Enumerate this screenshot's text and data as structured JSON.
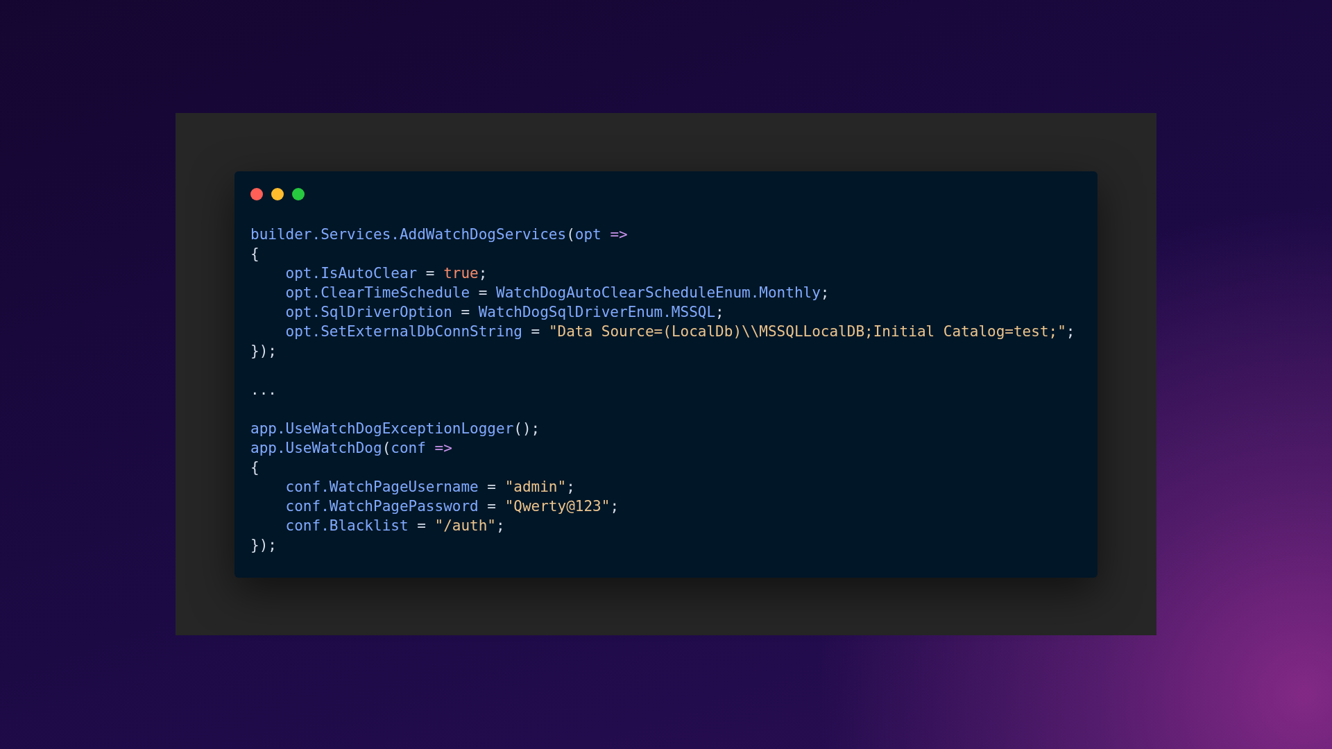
{
  "window_controls": [
    {
      "color": "#ff5f56"
    },
    {
      "color": "#ffbd2e"
    },
    {
      "color": "#27c93f"
    }
  ],
  "code_blocks": [
    {
      "lines": [
        {
          "indented": false,
          "tokens": [
            {
              "kind": "id",
              "text": "builder.Services.AddWatchDogServices"
            },
            {
              "kind": "p",
              "text": "("
            },
            {
              "kind": "id",
              "text": "opt "
            },
            {
              "kind": "op",
              "text": "=>"
            }
          ]
        },
        {
          "indented": false,
          "tokens": [
            {
              "kind": "p",
              "text": "{"
            }
          ]
        },
        {
          "indented": true,
          "tokens": [
            {
              "kind": "id",
              "text": "opt.IsAutoClear"
            },
            {
              "kind": "p",
              "text": " = "
            },
            {
              "kind": "kw",
              "text": "true"
            },
            {
              "kind": "p",
              "text": ";"
            }
          ]
        },
        {
          "indented": true,
          "tokens": [
            {
              "kind": "id",
              "text": "opt.ClearTimeSchedule"
            },
            {
              "kind": "p",
              "text": " = "
            },
            {
              "kind": "id",
              "text": "WatchDogAutoClearScheduleEnum.Monthly"
            },
            {
              "kind": "p",
              "text": ";"
            }
          ]
        },
        {
          "indented": true,
          "tokens": [
            {
              "kind": "id",
              "text": "opt.SqlDriverOption"
            },
            {
              "kind": "p",
              "text": " = "
            },
            {
              "kind": "id",
              "text": "WatchDogSqlDriverEnum.MSSQL"
            },
            {
              "kind": "p",
              "text": ";"
            }
          ]
        },
        {
          "indented": true,
          "tokens": [
            {
              "kind": "id",
              "text": "opt.SetExternalDbConnString"
            },
            {
              "kind": "p",
              "text": " = "
            },
            {
              "kind": "str",
              "text": "\"Data Source=(LocalDb)\\\\MSSQLLocalDB;Initial Catalog=test;\""
            },
            {
              "kind": "p",
              "text": ";"
            }
          ]
        },
        {
          "indented": false,
          "tokens": [
            {
              "kind": "p",
              "text": "});"
            }
          ]
        }
      ]
    },
    {
      "lines": [
        {
          "indented": false,
          "tokens": [
            {
              "kind": "p",
              "text": "..."
            }
          ]
        }
      ]
    },
    {
      "lines": [
        {
          "indented": false,
          "tokens": [
            {
              "kind": "id",
              "text": "app.UseWatchDogExceptionLogger"
            },
            {
              "kind": "p",
              "text": "();"
            }
          ]
        },
        {
          "indented": false,
          "tokens": [
            {
              "kind": "id",
              "text": "app.UseWatchDog"
            },
            {
              "kind": "p",
              "text": "("
            },
            {
              "kind": "id",
              "text": "conf "
            },
            {
              "kind": "op",
              "text": "=>"
            }
          ]
        },
        {
          "indented": false,
          "tokens": [
            {
              "kind": "p",
              "text": "{"
            }
          ]
        },
        {
          "indented": true,
          "tokens": [
            {
              "kind": "id",
              "text": "conf.WatchPageUsername"
            },
            {
              "kind": "p",
              "text": " = "
            },
            {
              "kind": "str",
              "text": "\"admin\""
            },
            {
              "kind": "p",
              "text": ";"
            }
          ]
        },
        {
          "indented": true,
          "tokens": [
            {
              "kind": "id",
              "text": "conf.WatchPagePassword"
            },
            {
              "kind": "p",
              "text": " = "
            },
            {
              "kind": "str",
              "text": "\"Qwerty@123\""
            },
            {
              "kind": "p",
              "text": ";"
            }
          ]
        },
        {
          "indented": true,
          "tokens": [
            {
              "kind": "id",
              "text": "conf.Blacklist"
            },
            {
              "kind": "p",
              "text": " = "
            },
            {
              "kind": "str",
              "text": "\"/auth\""
            },
            {
              "kind": "p",
              "text": ";"
            }
          ]
        },
        {
          "indented": false,
          "tokens": [
            {
              "kind": "p",
              "text": "});"
            }
          ]
        }
      ]
    }
  ]
}
